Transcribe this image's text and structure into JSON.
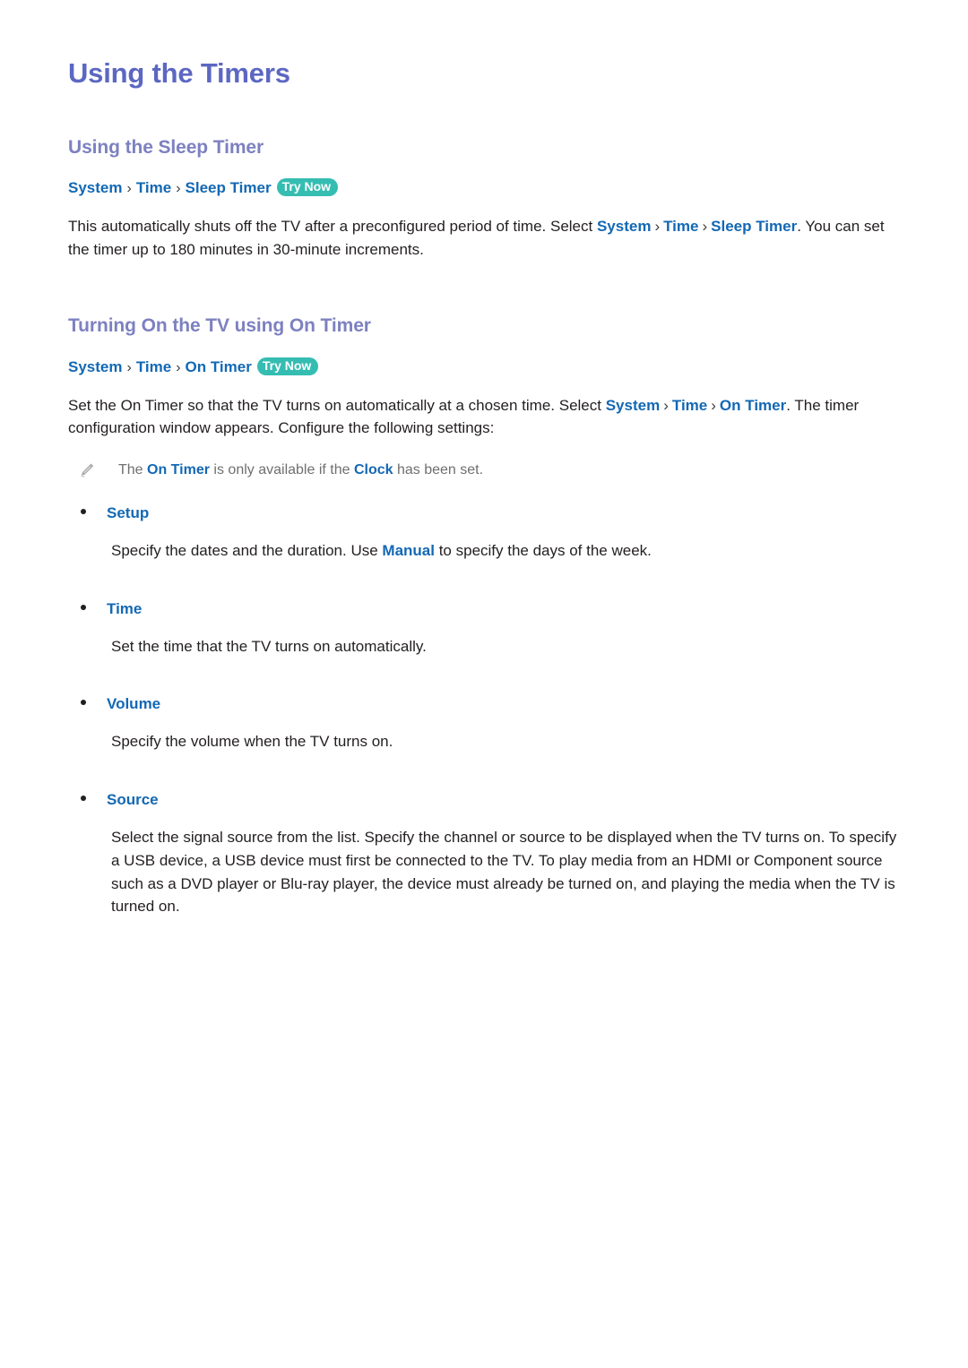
{
  "document": {
    "title": "Using the Timers"
  },
  "colors": {
    "title": "#5c67c2",
    "section_heading": "#7d81c0",
    "link_blue": "#1368b4",
    "badge_teal": "#35bdb2",
    "body_text": "#231f20",
    "note_text": "#6f6f6f",
    "background": "#ffffff"
  },
  "sections": [
    {
      "heading": "Using the Sleep Timer",
      "breadcrumb": {
        "crumbs": [
          "System",
          "Time",
          "Sleep Timer"
        ],
        "separator": "›",
        "badge": "Try Now"
      },
      "paragraph": {
        "part1": "This automatically shuts off the TV after a preconfigured period of time. Select ",
        "link1": "System",
        "sep1": "›",
        "link2": "Time",
        "sep2": "›",
        "link3": "Sleep Timer",
        "part2": ". You can set the timer up to 180 minutes in 30-minute increments."
      }
    },
    {
      "heading": "Turning On the TV using On Timer",
      "breadcrumb": {
        "crumbs": [
          "System",
          "Time",
          "On Timer"
        ],
        "separator": "›",
        "badge": "Try Now"
      },
      "paragraph": {
        "part1": "Set the On Timer so that the TV turns on automatically at a chosen time. Select ",
        "link1": "System",
        "sep1": "›",
        "link2": "Time",
        "sep2": "›",
        "link3": "On Timer",
        "part2": ". The timer configuration window appears. Configure the following settings:"
      },
      "note": {
        "icon": "pencil-icon",
        "part1": "The ",
        "link1": "On Timer",
        "part2": " is only available if the ",
        "link2": "Clock",
        "part3": " has been set."
      },
      "bullets": [
        {
          "label": "Setup",
          "desc_part1": "Specify the dates and the duration. Use ",
          "desc_link": "Manual",
          "desc_part2": " to specify the days of the week."
        },
        {
          "label": "Time",
          "desc_part1": "Set the time that the TV turns on automatically.",
          "desc_link": "",
          "desc_part2": ""
        },
        {
          "label": "Volume",
          "desc_part1": "Specify the volume when the TV turns on.",
          "desc_link": "",
          "desc_part2": ""
        },
        {
          "label": "Source",
          "desc_part1": "Select the signal source from the list. Specify the channel or source to be displayed when the TV turns on. To specify a USB device, a USB device must first be connected to the TV. To play media from an HDMI or Component source such as a DVD player or Blu-ray player, the device must already be turned on, and playing the media when the TV is turned on.",
          "desc_link": "",
          "desc_part2": ""
        }
      ]
    }
  ]
}
